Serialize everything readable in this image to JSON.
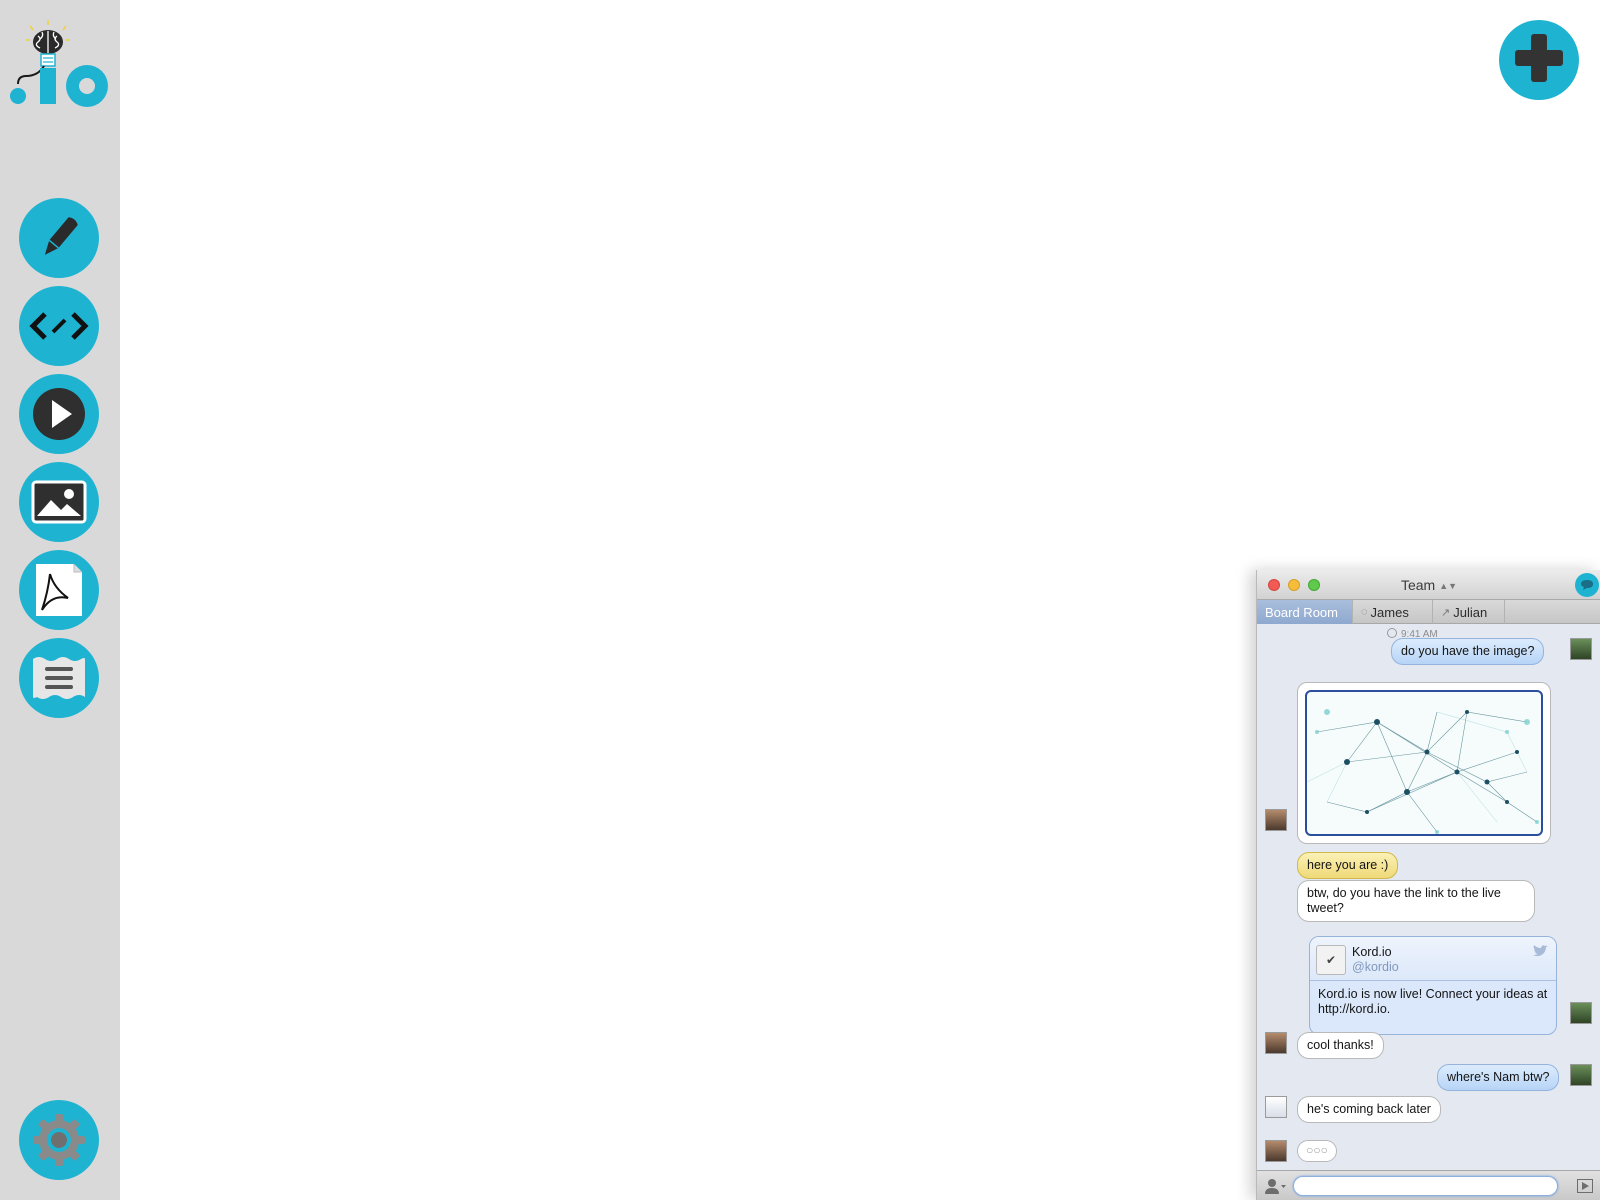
{
  "app": {
    "logo_alt": ".io"
  },
  "sidebar": {
    "tools": [
      {
        "name": "pen-tool",
        "icon": "pen-icon"
      },
      {
        "name": "code-tool",
        "icon": "code-icon"
      },
      {
        "name": "video-tool",
        "icon": "play-icon"
      },
      {
        "name": "image-tool",
        "icon": "image-icon"
      },
      {
        "name": "pdf-tool",
        "icon": "pdf-icon"
      },
      {
        "name": "text-tool",
        "icon": "text-lines-icon"
      }
    ],
    "settings_icon": "gear-icon"
  },
  "add_button": {
    "icon": "plus-icon"
  },
  "colors": {
    "accent": "#1fb3d2",
    "sidebar_bg": "#d9d9d9",
    "out_bubble": "#b7d4f6",
    "highlight_bubble": "#efd978"
  },
  "chat": {
    "title": "Team",
    "tabs": [
      {
        "label": "Board Room",
        "active": true
      },
      {
        "label": "James",
        "icon": "speech-bubble-icon"
      },
      {
        "label": "Julian",
        "icon": "activity-icon"
      }
    ],
    "timestamp": "9:41 AM",
    "messages": {
      "m1": "do you have the image?",
      "m2": "here you are :)",
      "m3": "btw, do you have the link to the live tweet?",
      "m4": "cool thanks!",
      "m5": "where's Nam btw?",
      "m6": "he's coming back later"
    },
    "tweet": {
      "name": "Kord.io",
      "handle": "@kordio",
      "text": "Kord.io is now live! Connect your ideas at http://kord.io."
    },
    "typing_indicator": "○○○",
    "input": {
      "value": "",
      "placeholder": ""
    }
  }
}
